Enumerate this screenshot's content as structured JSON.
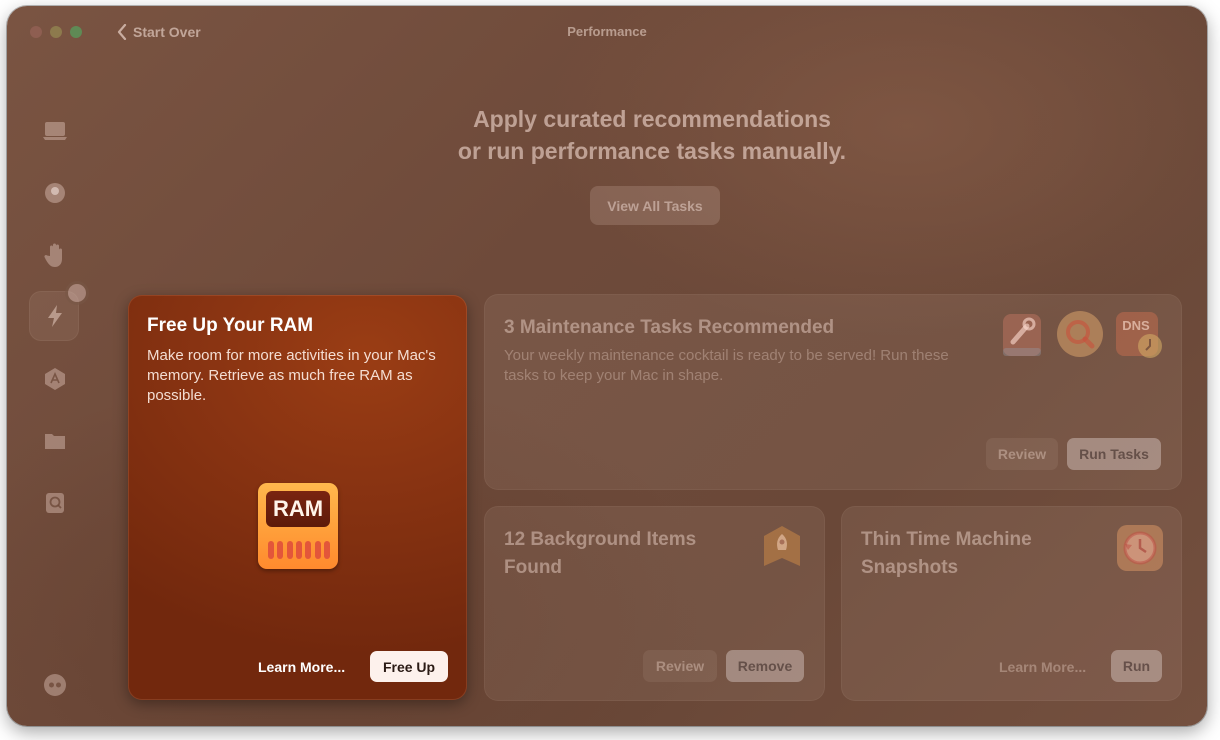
{
  "window": {
    "title": "Performance",
    "back_label": "Start Over"
  },
  "headline": {
    "line1": "Apply curated recommendations",
    "line2": "or run performance tasks manually."
  },
  "view_all_label": "View All Tasks",
  "sidebar": {
    "items": [
      {
        "icon": "laptop-icon"
      },
      {
        "icon": "shield-icon"
      },
      {
        "icon": "hand-icon"
      },
      {
        "icon": "lightning-icon",
        "active": true
      },
      {
        "icon": "applications-icon"
      },
      {
        "icon": "folder-icon"
      },
      {
        "icon": "search-files-icon"
      }
    ],
    "bottom_icon": "assistant-icon"
  },
  "cards": {
    "ram": {
      "title": "Free Up Your RAM",
      "description": "Make room for more activities in your Mac's memory. Retrieve as much free RAM as possible.",
      "icon_text": "RAM",
      "learn_more": "Learn More...",
      "action": "Free Up"
    },
    "maintenance": {
      "title": "3 Maintenance Tasks Recommended",
      "description": "Your weekly maintenance cocktail is ready to be served! Run these tasks to keep your Mac in shape.",
      "dns_label": "DNS",
      "review": "Review",
      "action": "Run Tasks"
    },
    "background": {
      "title": "12 Background Items Found",
      "review": "Review",
      "action": "Remove"
    },
    "snapshots": {
      "title": "Thin Time Machine Snapshots",
      "learn_more": "Learn More...",
      "action": "Run"
    }
  },
  "colors": {
    "window_bg": "#6e4a3a",
    "ram_card": "#8a3412",
    "ram_icon": "#ff9f3a"
  }
}
